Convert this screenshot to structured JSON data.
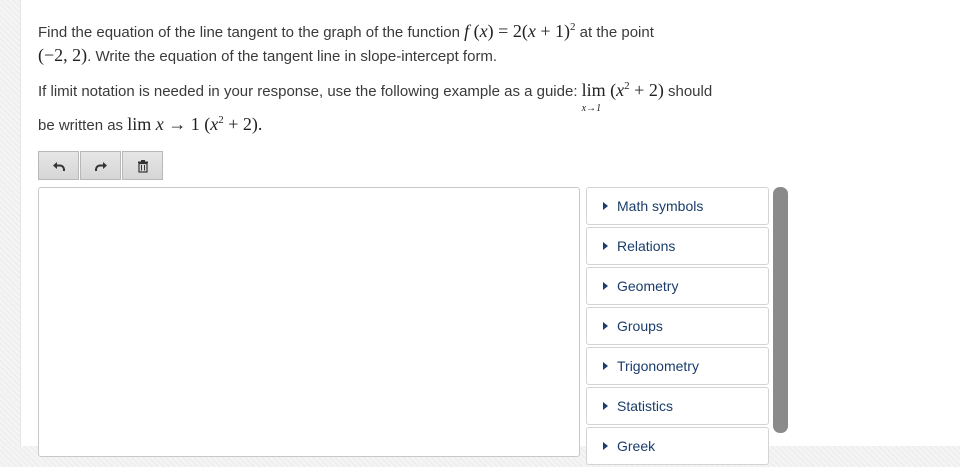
{
  "question": {
    "line1_text_a": "Find the equation of the line tangent to the graph of the function ",
    "func_f": "f",
    "func_x": "x",
    "func_rhs": "2(",
    "func_x2": "x",
    "func_rhs_b": " + 1)",
    "func_exp": "2",
    "line1_text_b": " at the point",
    "point": "(−2, 2)",
    "line2_text": ". Write the equation of the tangent line in slope-intercept form.",
    "line3_text": "If limit notation is needed in your response, use the following example as a guide: ",
    "lim_word": "lim",
    "lim_sub": "x→1",
    "lim_expr_open": " (",
    "lim_x": "x",
    "lim_exp": "2",
    "lim_expr_close": " + 2)",
    "line3_tail": " should",
    "line4_text": "be written as ",
    "line4_math_a": "lim ",
    "line4_x": "x",
    "line4_math_b": " → 1 (",
    "line4_x2": "x",
    "line4_exp": "2",
    "line4_math_c": " + 2)",
    "line4_end": "."
  },
  "toolbar": {
    "undo_icon": "undo-icon",
    "redo_icon": "redo-icon",
    "delete_icon": "trash-icon"
  },
  "editor": {
    "value": ""
  },
  "palette": {
    "items": [
      {
        "label": "Math symbols"
      },
      {
        "label": "Relations"
      },
      {
        "label": "Geometry"
      },
      {
        "label": "Groups"
      },
      {
        "label": "Trigonometry"
      },
      {
        "label": "Statistics"
      },
      {
        "label": "Greek"
      }
    ]
  },
  "colors": {
    "link": "#1a3d6b",
    "scrollbar": "#8a8a8a"
  }
}
